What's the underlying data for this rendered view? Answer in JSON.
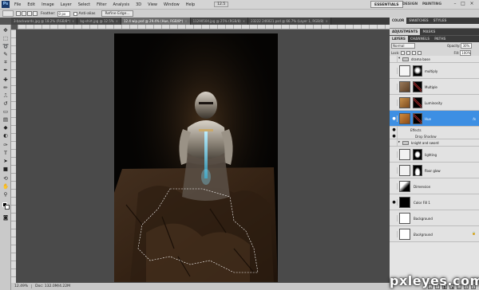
{
  "menubar": {
    "logo": "Ps",
    "items": [
      "File",
      "Edit",
      "Image",
      "Layer",
      "Select",
      "Filter",
      "Analysis",
      "3D",
      "View",
      "Window",
      "Help"
    ],
    "zoom": "12.5",
    "workspaces": [
      "ESSENTIALS",
      "DESIGN",
      "PAINTING"
    ],
    "window_controls": [
      "–",
      "□",
      "×"
    ]
  },
  "options": {
    "feather_label": "Feather:",
    "feather_value": "0 px",
    "antialias_label": "Anti-alias",
    "refine_button": "Refine Edge..."
  },
  "doc_tabs": [
    {
      "label": "3-backwards.jpg @ 18.2% (RGB/8*)",
      "active": false
    },
    {
      "label": "bg-shirt.jpg @ 12.5%",
      "active": false
    },
    {
      "label": "12.4 wip.psd @ 29.4% (Hue, RGB/8*)",
      "active": true
    },
    {
      "label": "11290504.jpg @ 25% (RGB/8)",
      "active": false
    },
    {
      "label": "23222 246021.psd @ 66.7% (Layer 1, RGB/8)",
      "active": false
    }
  ],
  "status": {
    "zoom": "12.49%",
    "doc": "Doc: 132.0M/4.22M"
  },
  "panels": {
    "color_tabs": [
      "COLOR",
      "SWATCHES",
      "STYLES"
    ],
    "adjust_tabs": [
      "ADJUSTMENTS",
      "MASKS"
    ],
    "layer_tabs": [
      "LAYERS",
      "CHANNELS",
      "PATHS"
    ]
  },
  "layers": {
    "blend_mode": "Normal",
    "opacity_label": "Opacity:",
    "opacity": "30%",
    "lock_label": "Lock:",
    "fill_label": "Fill:",
    "fill": "100%",
    "rows": [
      {
        "name": "drama base",
        "kind": "group"
      },
      {
        "name": "multiply",
        "kind": "layer"
      },
      {
        "name": "Multiple",
        "kind": "layer"
      },
      {
        "name": "Luminosity",
        "kind": "layer"
      },
      {
        "name": "Hue",
        "kind": "layer",
        "selected": true,
        "fx": "fx"
      },
      {
        "name": "Effects",
        "kind": "fx-row"
      },
      {
        "name": "Drop Shadow",
        "kind": "fx-row"
      },
      {
        "name": "knight and sword",
        "kind": "group"
      },
      {
        "name": "lighting",
        "kind": "layer"
      },
      {
        "name": "floor glow",
        "kind": "layer"
      },
      {
        "name": "Dimension",
        "kind": "layer"
      },
      {
        "name": "Color Fill 1",
        "kind": "layer"
      },
      {
        "name": "Background",
        "kind": "layer"
      },
      {
        "name": "Background",
        "kind": "layer",
        "locked": true
      }
    ],
    "bottom_icons": [
      "link-icon",
      "fx-icon",
      "mask-icon",
      "adjustment-icon",
      "folder-icon",
      "new-layer-icon",
      "trash-icon"
    ]
  },
  "watermark": "pxleyes.com",
  "colors": {
    "selected_layer": "#3d8fe3",
    "workspace_bg": "#4a4a4a",
    "panel_bg": "#d6d6d6"
  }
}
